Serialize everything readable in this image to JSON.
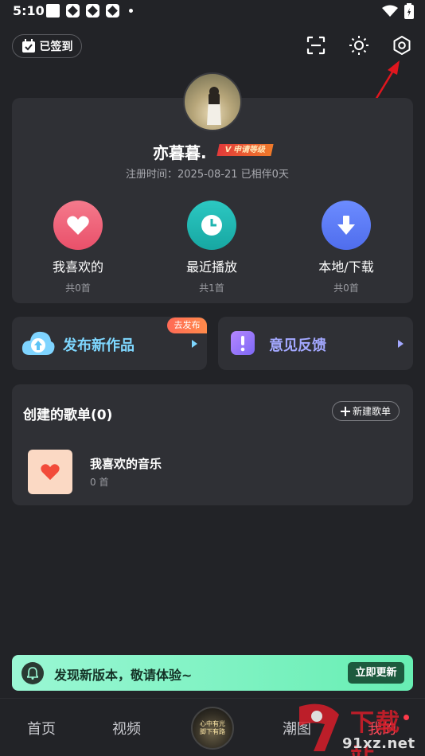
{
  "status_bar": {
    "time": "5:10"
  },
  "top_bar": {
    "signin_label": "已签到",
    "icons": [
      "scan-icon",
      "brightness-icon",
      "settings-icon"
    ]
  },
  "profile": {
    "username": "亦暮暮.",
    "level_badge": "V 申请等级",
    "registration": "注册时间：2025-08-21 已相伴0天"
  },
  "quick_actions": [
    {
      "label": "我喜欢的",
      "count": "共0首",
      "color": "#f2637b",
      "icon": "heart-icon"
    },
    {
      "label": "最近播放",
      "count": "共1首",
      "color": "#1fb5b0",
      "icon": "clock-icon"
    },
    {
      "label": "本地/下载",
      "count": "共0首",
      "color": "#5b7cf5",
      "icon": "download-icon"
    }
  ],
  "publish": {
    "title": "发布新作品",
    "badge": "去发布"
  },
  "feedback": {
    "title": "意见反馈"
  },
  "playlists": {
    "title": "创建的歌单(0)",
    "new_button": "新建歌单",
    "items": [
      {
        "name": "我喜欢的音乐",
        "count": "0 首"
      }
    ]
  },
  "update_banner": {
    "text": "发现新版本，敬请体验~",
    "button": "立即更新"
  },
  "bottom_nav": {
    "items": [
      "首页",
      "视频",
      "潮图",
      "我的"
    ],
    "active": "我的",
    "disc_text": "心中有光\n脚下有路"
  },
  "watermark": {
    "cn": "下载站",
    "domain": "91xz.net"
  },
  "colors": {
    "accent": "#ff4a5a",
    "background": "#222327",
    "card": "#2f3035",
    "annotation_arrow": "#e0161e"
  }
}
